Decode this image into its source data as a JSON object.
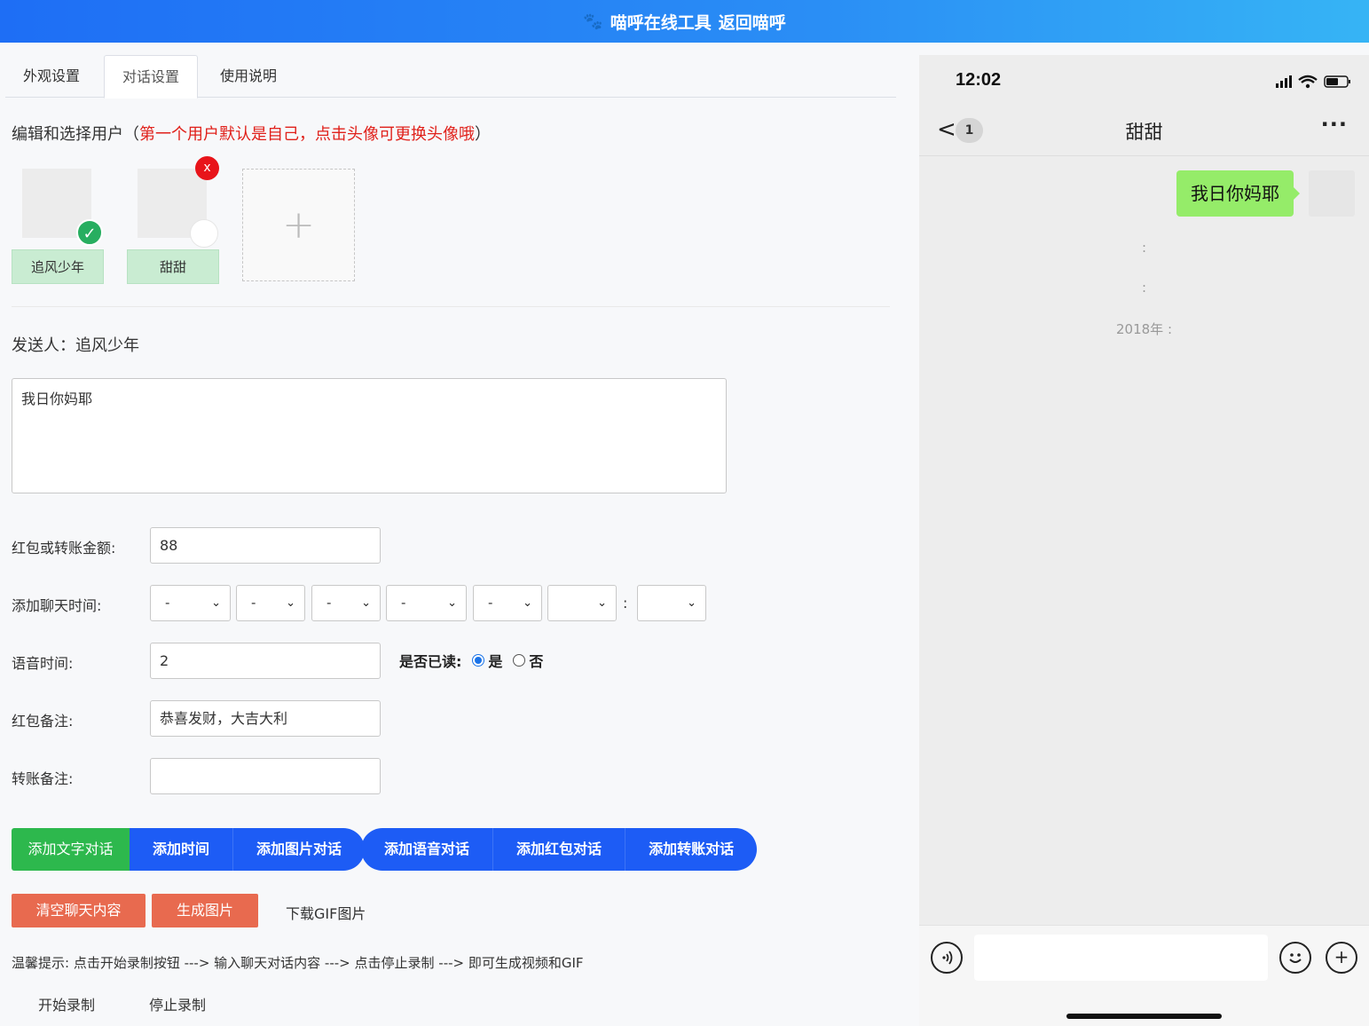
{
  "topbar": {
    "icon": "paw-icon",
    "title": "喵呼在线工具",
    "back_link": "返回喵呼",
    "colors": {
      "start": "#1e6ef5",
      "end": "#36b4f5"
    }
  },
  "tabs": [
    {
      "label": "外观设置"
    },
    {
      "label": "对话设置",
      "active": true
    },
    {
      "label": "使用说明"
    }
  ],
  "users_section": {
    "title": "编辑和选择用户（",
    "hint": "第一个用户默认是自己，点击头像可更换头像哦",
    "close": "）"
  },
  "users": [
    {
      "name": "追风少年",
      "selected": true
    },
    {
      "name": "甜甜",
      "selected": false,
      "delete_label": "x"
    }
  ],
  "add_user_label": "+",
  "sender": {
    "label": "发送人：",
    "name": "追风少年"
  },
  "message_text": "我日你妈耶",
  "form": {
    "amount": {
      "label": "红包或转账金额:",
      "value": "88"
    },
    "chat_time": {
      "label": "添加聊天时间:",
      "selects": [
        "-",
        "-",
        "-",
        "-",
        "-",
        "",
        ""
      ],
      "colon": ":"
    },
    "voice_time": {
      "label": "语音时间:",
      "value": "2"
    },
    "read": {
      "label": "是否已读:",
      "yes": "是",
      "no": "否",
      "selected": "是"
    },
    "redpacket_note": {
      "label": "红包备注:",
      "value": "恭喜发财，大吉大利"
    },
    "transfer_note": {
      "label": "转账备注:",
      "value": ""
    }
  },
  "buttons": {
    "add_text": "添加文字对话",
    "add_time": "添加时间",
    "add_image": "添加图片对话",
    "add_voice": "添加语音对话",
    "add_redpacket": "添加红包对话",
    "add_transfer": "添加转账对话",
    "clear": "清空聊天内容",
    "generate": "生成图片",
    "download_gif": "下载GIF图片",
    "start_record": "开始录制",
    "stop_record": "停止录制"
  },
  "tip": "温馨提示: 点击开始录制按钮 ---> 输入聊天对话内容 ---> 点击停止录制 ---> 即可生成视频和GIF",
  "phone": {
    "time": "12:02",
    "unread": "1",
    "chat_title": "甜甜",
    "more": "···",
    "bubble": "我日你妈耶",
    "sys_lines": [
      ":",
      ":",
      "2018年 :"
    ],
    "bubble_color": "#95ec69"
  }
}
